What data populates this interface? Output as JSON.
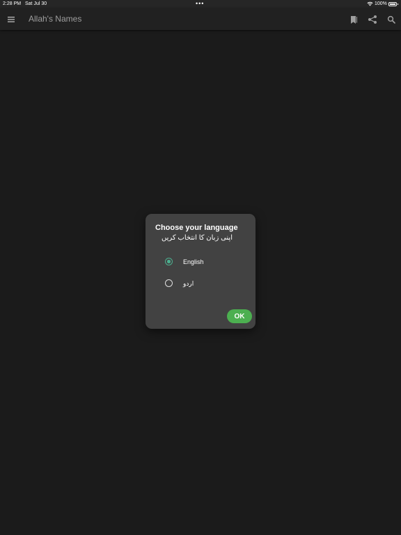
{
  "status_bar": {
    "time": "2:28 PM",
    "date": "Sat Jul 30",
    "multitasking": "•••",
    "battery": "100%",
    "battery_level": 1.0,
    "icons": [
      "wifi-icon",
      "battery-icon"
    ]
  },
  "app_bar": {
    "title": "Allah's Names",
    "icons": [
      "menu-icon",
      "bookmark-icon",
      "share-icon",
      "search-icon"
    ],
    "background": "#212121",
    "title_color": "#9e9e9e"
  },
  "language_dialog": {
    "heading": "Choose your language",
    "subheading": "اپنی زبان کا انتخاب کریں",
    "options": [
      {
        "label": "English",
        "selected": true
      },
      {
        "label": "اردو",
        "selected": false
      }
    ],
    "ok_label": "OK",
    "accent_color": "#4caf8f",
    "ok_color": "#4caf50",
    "background": "#424242"
  },
  "page_background": "#1b1b1b"
}
